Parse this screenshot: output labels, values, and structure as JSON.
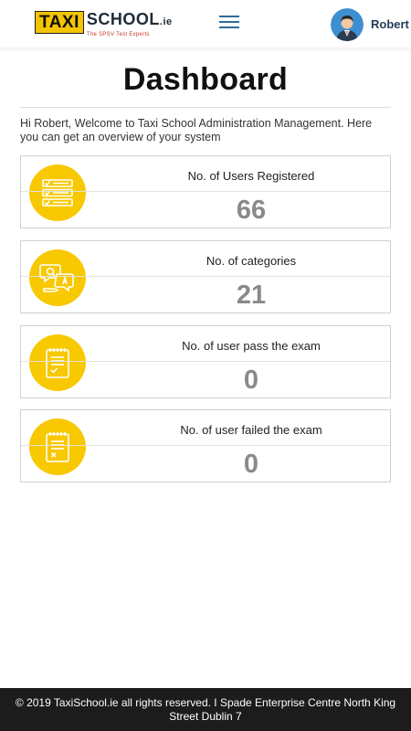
{
  "header": {
    "logo": {
      "taxi": "TAXI",
      "school": "SCHOOL",
      "suffix": ".ie",
      "tagline": "The SPSV Test Experts"
    },
    "user_name": "Robert"
  },
  "main": {
    "title": "Dashboard",
    "welcome": "Hi Robert, Welcome to Taxi School Administration Management. Here you can get an overview of your system",
    "cards": [
      {
        "label": "No. of Users Registered",
        "value": "66",
        "icon": "checklist-icon"
      },
      {
        "label": "No. of categories",
        "value": "21",
        "icon": "chat-bubbles-icon"
      },
      {
        "label": "No. of user pass the exam",
        "value": "0",
        "icon": "document-check-icon"
      },
      {
        "label": "No. of user failed the exam",
        "value": "0",
        "icon": "document-fail-icon"
      }
    ]
  },
  "footer": {
    "text": "© 2019 TaxiSchool.ie all rights reserved. I Spade Enterprise Centre North King Street Dublin 7"
  },
  "colors": {
    "accent": "#f8c800",
    "menu": "#2a6d9e",
    "footer_bg": "#1c1c1c",
    "value_text": "#8a8a8a"
  }
}
